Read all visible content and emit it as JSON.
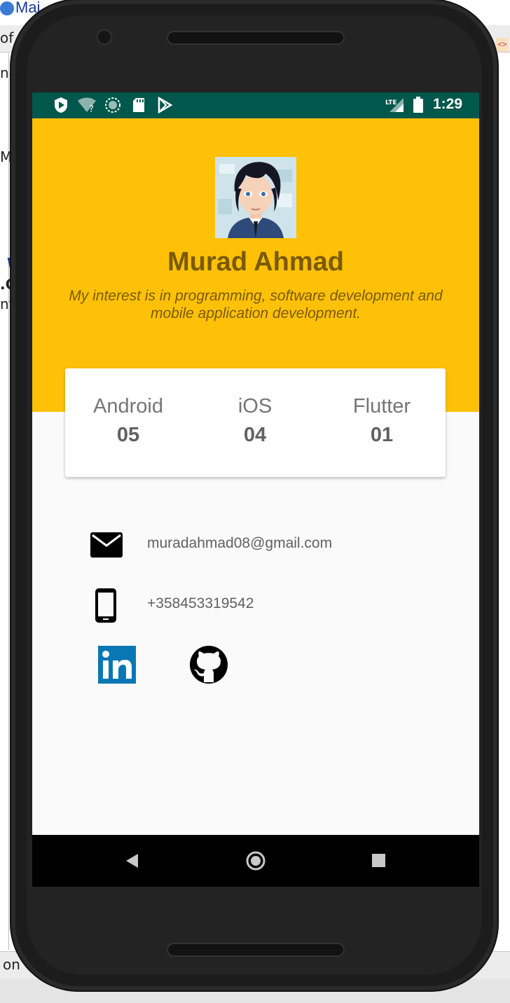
{
  "ide": {
    "tab_label": "Mai",
    "left_fragments": [
      "of",
      "nd",
      "Ma",
      "W",
      ".C",
      "nt",
      "on"
    ],
    "right_marker": "<>"
  },
  "statusbar": {
    "time": "1:29",
    "network": "LTE",
    "icons": [
      "shield-play-icon",
      "wifi-question-icon",
      "sync-circle-icon",
      "sd-card-icon",
      "play-store-icon",
      "signal-lte-icon",
      "battery-icon"
    ]
  },
  "profile": {
    "name": "Murad Ahmad",
    "bio": "My interest is in programming, software development and mobile application development."
  },
  "stats": [
    {
      "label": "Android",
      "value": "05"
    },
    {
      "label": "iOS",
      "value": "04"
    },
    {
      "label": "Flutter",
      "value": "01"
    }
  ],
  "contact": {
    "email": "muradahmad08@gmail.com",
    "phone": "+358453319542"
  },
  "social": [
    "linkedin-icon",
    "github-icon"
  ],
  "colors": {
    "statusbar": "#00574b",
    "header": "#ffc107",
    "name_text": "#7a5a00",
    "linkedin": "#0a77b5"
  }
}
